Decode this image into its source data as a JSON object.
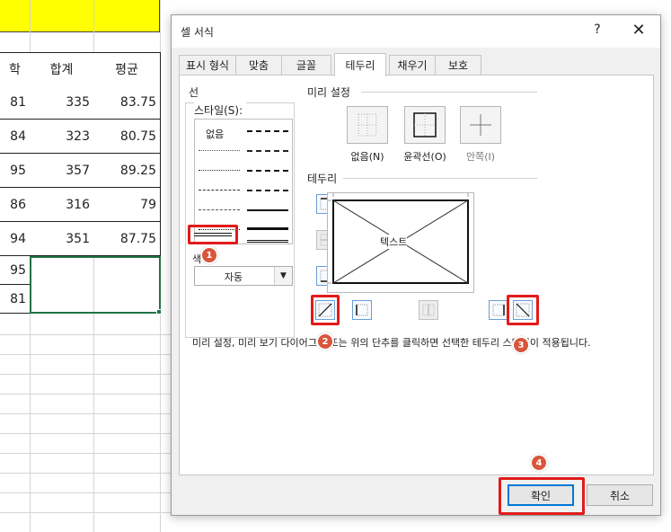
{
  "sheet": {
    "headers": [
      "학",
      "합계",
      "평균"
    ],
    "rows": [
      [
        "81",
        "335",
        "83.75"
      ],
      [
        "84",
        "323",
        "80.75"
      ],
      [
        "95",
        "357",
        "89.25"
      ],
      [
        "86",
        "316",
        "79"
      ],
      [
        "94",
        "351",
        "87.75"
      ],
      [
        "95",
        "",
        ""
      ],
      [
        "81",
        "",
        ""
      ]
    ]
  },
  "dialog": {
    "title": "셀 서식",
    "help": "?",
    "close": "✕",
    "tabs": [
      "표시 형식",
      "맞춤",
      "글꼴",
      "테두리",
      "채우기",
      "보호"
    ],
    "active_tab": "테두리",
    "line_group": {
      "label": "선",
      "style_label": "스타일(S):",
      "none_label": "없음",
      "color_label": "색",
      "color_value": "자동"
    },
    "presets": {
      "label": "미리 설정",
      "items": [
        "없음(N)",
        "윤곽선(O)",
        "안쪽(I)"
      ]
    },
    "border_group": {
      "label": "테두리",
      "preview_text": "텍스트"
    },
    "help_text": "미리 설정, 미리 보기 다이어그램 또는 위의 단추를 클릭하면 선택한 테두리 스타일이 적용됩니다.",
    "ok_label": "확인",
    "cancel_label": "취소"
  },
  "annotations": [
    "1",
    "2",
    "3",
    "4"
  ],
  "colors": {
    "highlight": "#e21b1b",
    "badge": "#d9553b",
    "selection": "#217346",
    "header_fill": "#ffff00"
  }
}
